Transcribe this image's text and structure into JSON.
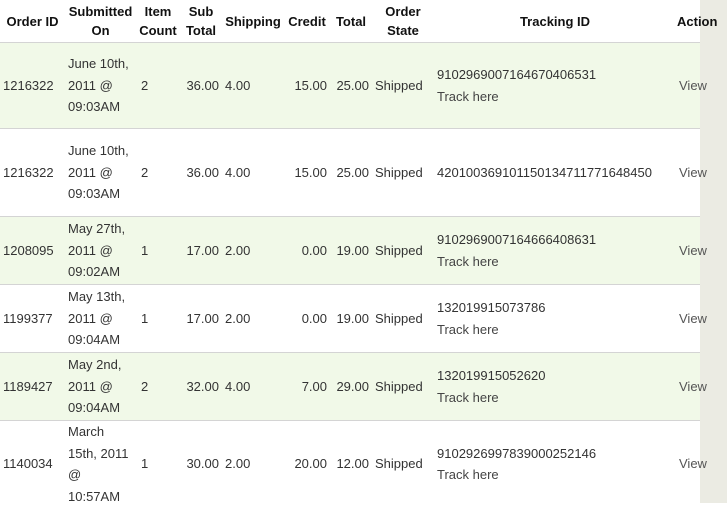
{
  "headers": [
    "Order ID",
    "Submitted On",
    "Item Count",
    "Sub Total",
    "Shipping",
    "Credit",
    "Total",
    "Order State",
    "Tracking ID",
    "Action"
  ],
  "rows": [
    {
      "order_id": "1216322",
      "submitted": "June 10th, 2011 @ 09:03AM",
      "items": "2",
      "subtotal": "36.00",
      "shipping": "4.00",
      "credit": "15.00",
      "total": "25.00",
      "state": "Shipped",
      "tracking": "9102969007164670406531",
      "track_link": "Track here",
      "action": "View"
    },
    {
      "order_id": "1216322",
      "submitted": "June 10th, 2011 @ 09:03AM",
      "items": "2",
      "subtotal": "36.00",
      "shipping": "4.00",
      "credit": "15.00",
      "total": "25.00",
      "state": "Shipped",
      "tracking": "420100369101150134711771648450",
      "track_link": "",
      "action": "View"
    },
    {
      "order_id": "1208095",
      "submitted": "May 27th, 2011 @ 09:02AM",
      "items": "1",
      "subtotal": "17.00",
      "shipping": "2.00",
      "credit": "0.00",
      "total": "19.00",
      "state": "Shipped",
      "tracking": "9102969007164666408631",
      "track_link": "Track here",
      "action": "View"
    },
    {
      "order_id": "1199377",
      "submitted": "May 13th, 2011 @ 09:04AM",
      "items": "1",
      "subtotal": "17.00",
      "shipping": "2.00",
      "credit": "0.00",
      "total": "19.00",
      "state": "Shipped",
      "tracking": "132019915073786",
      "track_link": "Track here",
      "action": "View"
    },
    {
      "order_id": "1189427",
      "submitted": "May 2nd, 2011 @ 09:04AM",
      "items": "2",
      "subtotal": "32.00",
      "shipping": "4.00",
      "credit": "7.00",
      "total": "29.00",
      "state": "Shipped",
      "tracking": "132019915052620",
      "track_link": "Track here",
      "action": "View"
    },
    {
      "order_id": "1140034",
      "submitted": "March 15th, 2011 @ 10:57AM",
      "items": "1",
      "subtotal": "30.00",
      "shipping": "2.00",
      "credit": "20.00",
      "total": "12.00",
      "state": "Shipped",
      "tracking": "9102926997839000252146",
      "track_link": "Track here",
      "action": "View"
    }
  ]
}
